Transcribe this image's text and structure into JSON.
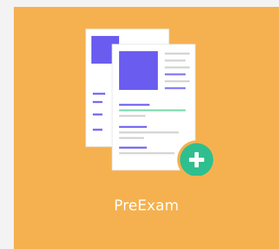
{
  "tile": {
    "label": "PreExam",
    "background_color": "#f5b14f",
    "icon": "document-add-icon",
    "badge_icon": "plus-icon",
    "badge_color": "#2fbf8f",
    "accent_color": "#6b5cf0"
  }
}
